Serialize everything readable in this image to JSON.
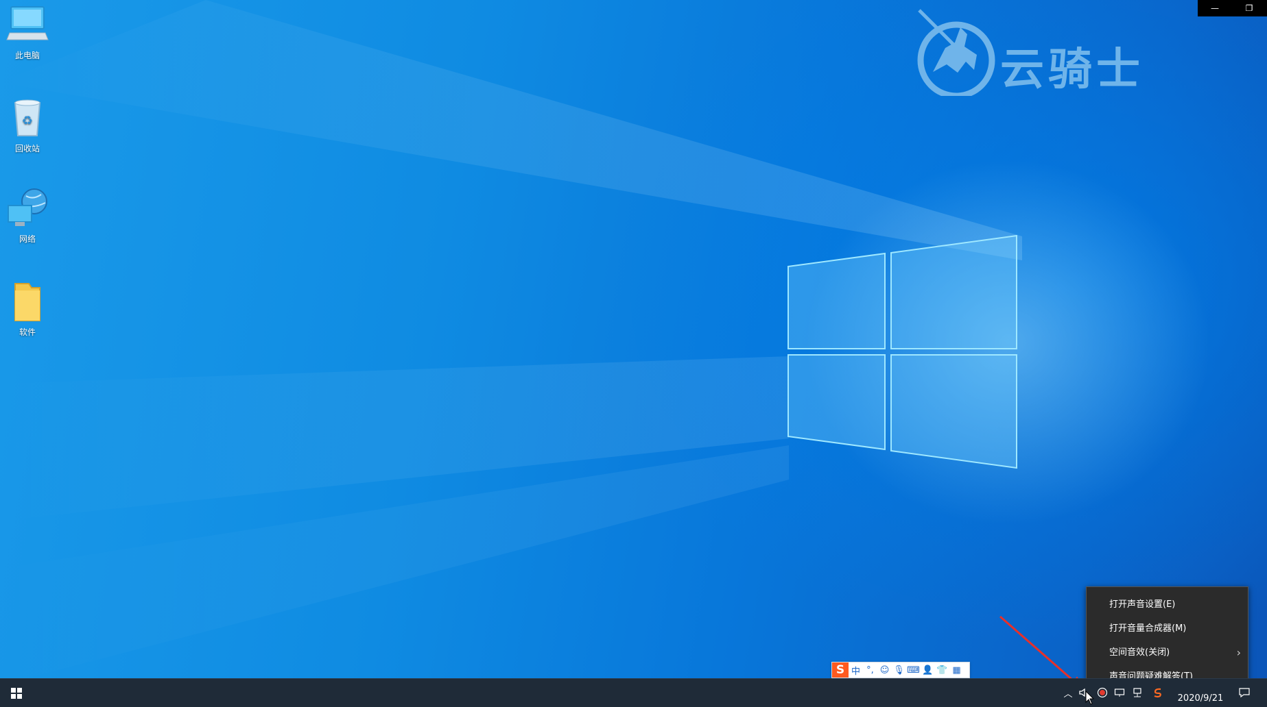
{
  "desktop": {
    "icons": [
      {
        "label": "此电脑",
        "icon": "computer-icon"
      },
      {
        "label": "回收站",
        "icon": "recycle-bin-icon"
      },
      {
        "label": "网络",
        "icon": "network-icon"
      },
      {
        "label": "软件",
        "icon": "folder-icon"
      }
    ]
  },
  "watermark": {
    "text": "云骑士",
    "icon": "knight-logo-icon",
    "color": "#6fb4ea"
  },
  "window_controls": {
    "minimize": "—",
    "restore": "❐"
  },
  "ime_bar": {
    "logo": "S",
    "lang": "中",
    "punct": "°,",
    "icons": [
      "emoji-icon",
      "microphone-icon",
      "keyboard-icon",
      "user-icon",
      "skin-icon",
      "grid-icon"
    ]
  },
  "context_menu": {
    "items": [
      {
        "label": "打开声音设置(E)"
      },
      {
        "label": "打开音量合成器(M)"
      },
      {
        "label": "空间音效(关闭)",
        "submenu": true
      },
      {
        "label": "声音问题疑难解答(T)"
      }
    ]
  },
  "taskbar": {
    "clock_date": "2020/9/21",
    "accent": "#1f2b38",
    "tray_icons": [
      "chevron-up-icon",
      "speaker-icon",
      "record-icon",
      "display-icon",
      "network-tray-icon",
      "sogou-icon",
      "notification-icon"
    ]
  },
  "annotation_color": "#e8302a"
}
